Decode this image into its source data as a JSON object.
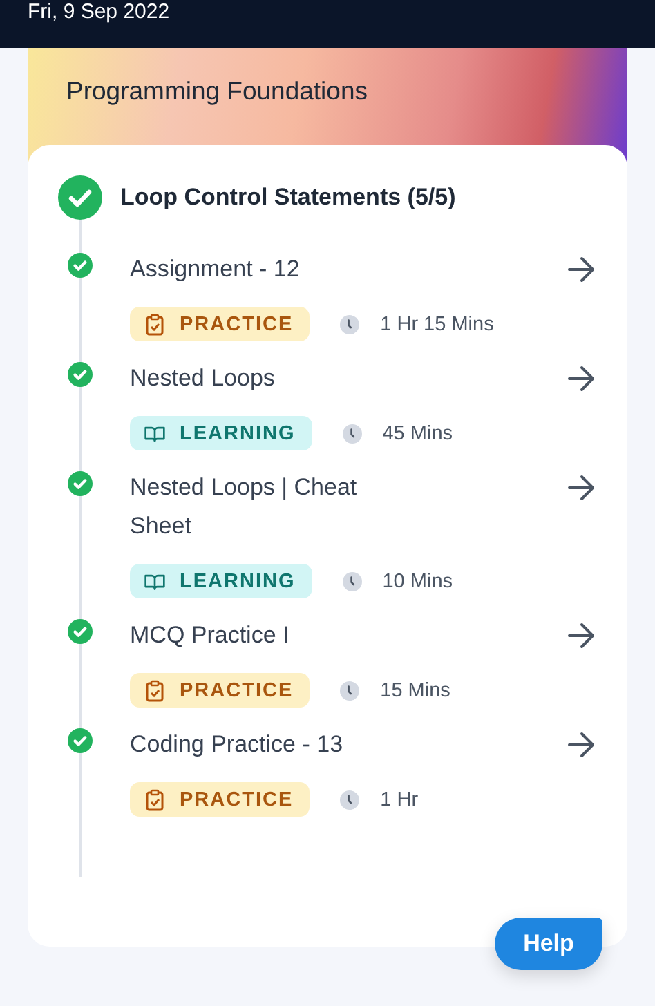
{
  "status_bar": {
    "date": "Fri, 9 Sep 2022"
  },
  "course": {
    "title": "Programming Foundations"
  },
  "section": {
    "title": "Loop Control Statements (5/5)",
    "completed": true
  },
  "items": [
    {
      "title": "Assignment - 12",
      "kind": "practice",
      "tag": "PRACTICE",
      "duration": "1 Hr 15 Mins",
      "completed": true
    },
    {
      "title": "Nested Loops",
      "kind": "learning",
      "tag": "LEARNING",
      "duration": "45 Mins",
      "completed": true
    },
    {
      "title": "Nested Loops | Cheat Sheet",
      "kind": "learning",
      "tag": "LEARNING",
      "duration": "10 Mins",
      "completed": true
    },
    {
      "title": "MCQ Practice I",
      "kind": "practice",
      "tag": "PRACTICE",
      "duration": "15 Mins",
      "completed": true
    },
    {
      "title": "Coding Practice - 13",
      "kind": "practice",
      "tag": "PRACTICE",
      "duration": "1 Hr",
      "completed": true
    }
  ],
  "help_button": "Help"
}
